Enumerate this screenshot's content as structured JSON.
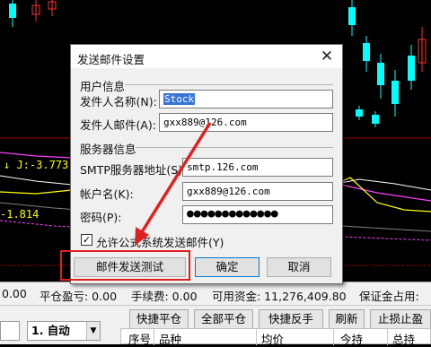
{
  "dialog": {
    "title": "发送邮件设置",
    "close_glyph": "✕",
    "user_group": "用户信息",
    "sender_name_label": "发件人名称(N):",
    "sender_name_value": "Stock",
    "sender_email_label": "发件人邮件(A):",
    "sender_email_value": "gxx889@126.com",
    "server_group": "服务器信息",
    "smtp_label": "SMTP服务器地址(S):",
    "smtp_value": "smtp.126.com",
    "account_label": "帐户名(K):",
    "account_value": "gxx889@126.com",
    "password_label": "密码(P):",
    "password_value": "●●●●●●●●●●●●●",
    "allow_checkbox_label": "允许公式系统发送邮件(Y)",
    "allow_checked": true,
    "test_button": "邮件发送测试",
    "ok_button": "确定",
    "cancel_button": "取消"
  },
  "chart": {
    "indicator_j": "J:-3.773",
    "indicator_left": "-1.814",
    "arrow_up": "↓",
    "arrow_up2": "↓"
  },
  "statusbar": {
    "item1": "0.00",
    "item2": "平仓盈亏: 0.00",
    "item3": "手续费: 0.00",
    "item4": "可用资金: 11,276,409.80",
    "item5": "保证金占用:"
  },
  "bottom": {
    "mode": "1. 自动",
    "buttons": [
      "快捷平仓",
      "全部平仓",
      "快捷反手",
      "刷新",
      "止损止盈"
    ],
    "columns": [
      "序号",
      "品种",
      "均价",
      "今持",
      "总持"
    ]
  },
  "colors": {
    "candle_up": "#ff3030",
    "candle_down": "#00ffff",
    "indicator_yellow": "#ffff00",
    "indicator_magenta": "#ff40ff",
    "annotation_red": "#e02020",
    "selection": "#3875d7"
  }
}
